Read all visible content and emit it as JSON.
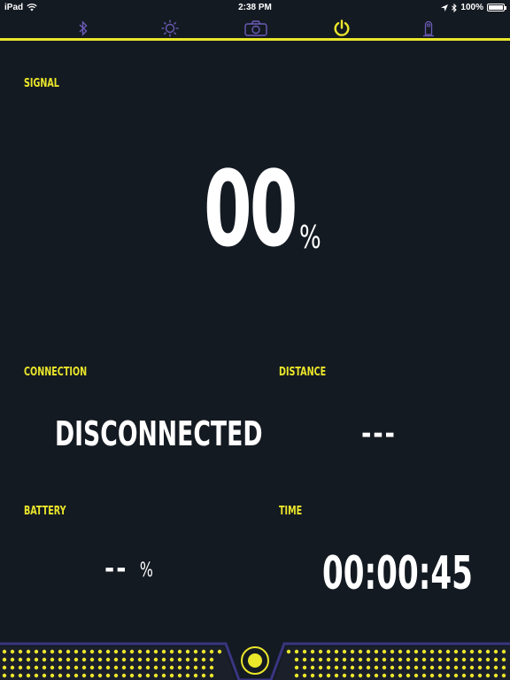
{
  "status_bar": {
    "device": "iPad",
    "time": "2:38 PM",
    "battery_percent": "100%"
  },
  "tabs": [
    {
      "icon": "bluetooth-icon",
      "active": false
    },
    {
      "icon": "sun-icon",
      "active": false
    },
    {
      "icon": "camera-icon",
      "active": false
    },
    {
      "icon": "power-icon",
      "active": true
    },
    {
      "icon": "robot-icon",
      "active": false
    }
  ],
  "signal": {
    "label": "SIGNAL",
    "value": "00",
    "unit": "%"
  },
  "connection": {
    "label": "CONNECTION",
    "value": "DISCONNECTED"
  },
  "distance": {
    "label": "DISTANCE",
    "value": "---"
  },
  "battery": {
    "label": "BATTERY",
    "value": "--",
    "unit": "%"
  },
  "time": {
    "label": "TIME",
    "value": "00:00:45"
  },
  "colors": {
    "background": "#141a22",
    "accent": "#eae62a",
    "tab_icon": "#6b5bb5",
    "bottom_bar": "#3a3580"
  }
}
